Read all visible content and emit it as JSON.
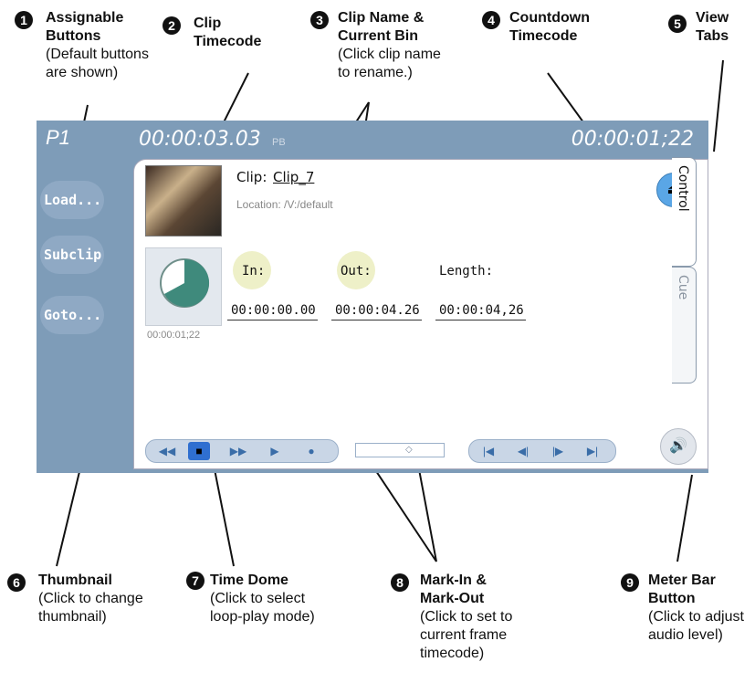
{
  "callouts": [
    {
      "num": "1",
      "title": "Assignable\nButtons",
      "desc": "(Default buttons\nare shown)"
    },
    {
      "num": "2",
      "title": "Clip\nTimecode",
      "desc": ""
    },
    {
      "num": "3",
      "title": "Clip Name &\nCurrent Bin",
      "desc": "(Click clip name\nto rename.)"
    },
    {
      "num": "4",
      "title": "Countdown\nTimecode",
      "desc": ""
    },
    {
      "num": "5",
      "title": "View\nTabs",
      "desc": ""
    },
    {
      "num": "6",
      "title": "Thumbnail",
      "desc": "(Click to change\nthumbnail)"
    },
    {
      "num": "7",
      "title": "Time Dome",
      "desc": "(Click to select\n loop-play mode)"
    },
    {
      "num": "8",
      "title": "Mark-In &\nMark-Out",
      "desc": "(Click to set to\ncurrent frame\ntimecode)"
    },
    {
      "num": "9",
      "title": "Meter Bar\nButton",
      "desc": "(Click to adjust\naudio level)"
    }
  ],
  "ui": {
    "channel": "P1",
    "clip_timecode": "00:00:03.03",
    "mode": "PB",
    "countdown_timecode": "00:00:01;22",
    "assign_buttons": [
      "Load...",
      "Subclip",
      "Goto..."
    ],
    "clip_label": "Clip:",
    "clip_name": "Clip_7",
    "location": "Location: /V:/default",
    "dome_timecode": "00:00:01;22",
    "in_label": "In:",
    "out_label": "Out:",
    "length_label": "Length:",
    "in_tc": "00:00:00.00",
    "out_tc": "00:00:04.26",
    "length_tc": "00:00:04,26",
    "tabs": [
      "Control",
      "Cue"
    ],
    "icons": {
      "eject": "eject-icon",
      "meter": "speaker-icon",
      "transport": [
        "rewind-icon",
        "stop-icon",
        "fast-forward-icon",
        "play-icon",
        "record-icon"
      ],
      "jog": [
        "go-to-start-icon",
        "step-back-icon",
        "step-forward-icon",
        "go-to-end-icon"
      ]
    }
  }
}
